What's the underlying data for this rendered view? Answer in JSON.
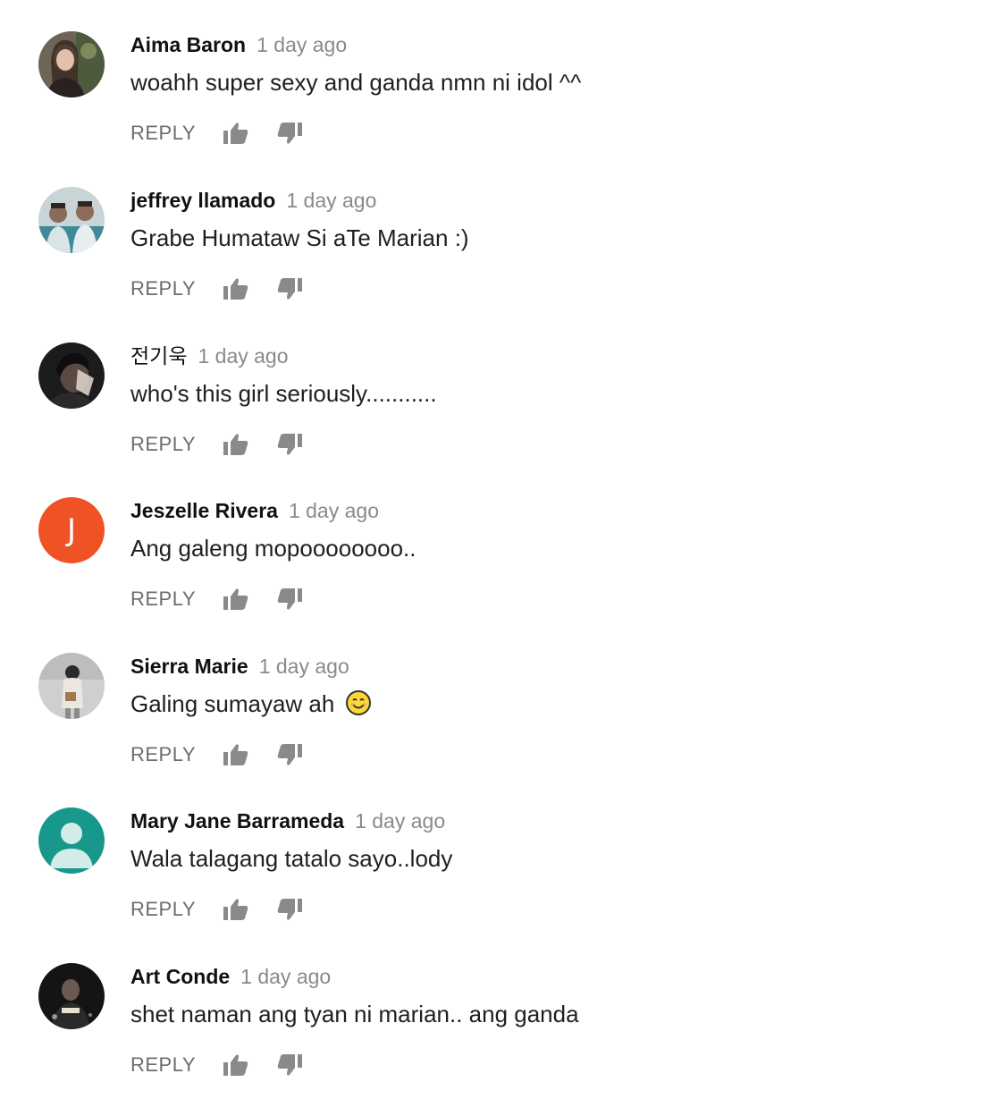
{
  "colors": {
    "author": "#111111",
    "timestamp": "#8a8a8a",
    "body": "#1f1f1f",
    "action": "#6d6d6d",
    "icon": "#8a8a8a",
    "initial_avatar_bg": "#ef5225",
    "default_avatar_bg": "#18988b"
  },
  "reply_label": "REPLY",
  "comments": [
    {
      "author": "Aima Baron",
      "time": "1 day ago",
      "text": "woahh super sexy and ganda nmn ni idol ^^",
      "avatar": "photo"
    },
    {
      "author": "jeffrey llamado",
      "time": "1 day ago",
      "text": "Grabe Humataw Si aTe Marian :)",
      "avatar": "photo"
    },
    {
      "author": "전기욱",
      "time": "1 day ago",
      "text": "who's this girl seriously...........",
      "avatar": "photo"
    },
    {
      "author": "Jeszelle Rivera",
      "time": "1 day ago",
      "text": "Ang galeng mopoooooooo..",
      "avatar": "initial",
      "initial": "J"
    },
    {
      "author": "Sierra Marie",
      "time": "1 day ago",
      "text": "Galing sumayaw ah",
      "avatar": "photo",
      "emoji": "smiling-face-icon"
    },
    {
      "author": "Mary Jane Barrameda",
      "time": "1 day ago",
      "text": "Wala talagang tatalo sayo..lody",
      "avatar": "default-person-icon"
    },
    {
      "author": "Art Conde",
      "time": "1 day ago",
      "text": "shet naman ang tyan ni marian.. ang ganda",
      "avatar": "photo"
    }
  ]
}
